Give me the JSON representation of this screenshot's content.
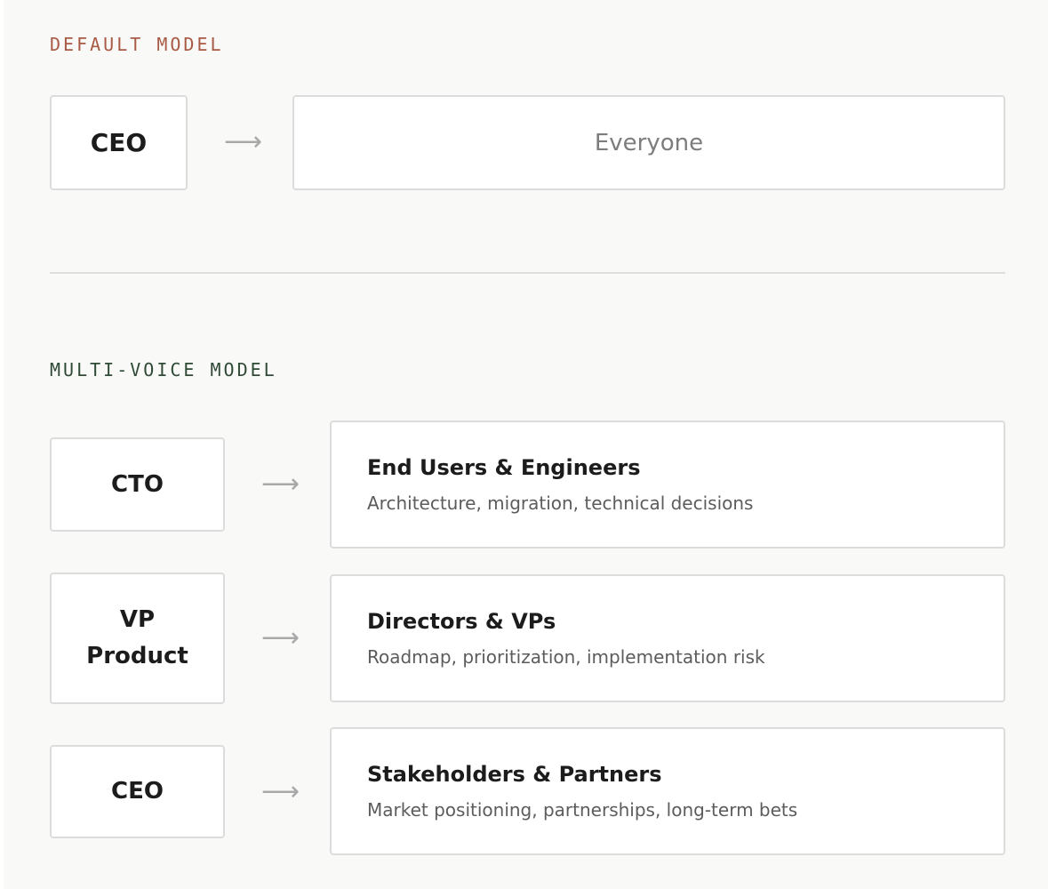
{
  "default_model": {
    "label": "DEFAULT MODEL",
    "label_color": "#a85a44",
    "role": "CEO",
    "arrow": "⟶",
    "audience": "Everyone"
  },
  "multi_voice_model": {
    "label": "MULTI-VOICE MODEL",
    "label_color": "#2f4a35",
    "rows": [
      {
        "role": "CTO",
        "arrow": "⟶",
        "title": "End Users & Engineers",
        "desc": "Architecture, migration, technical decisions"
      },
      {
        "role": "VP Product",
        "arrow": "⟶",
        "title": "Directors & VPs",
        "desc": "Roadmap, prioritization, implementation risk"
      },
      {
        "role": "CEO",
        "arrow": "⟶",
        "title": "Stakeholders & Partners",
        "desc": "Market positioning, partnerships, long-term bets"
      }
    ]
  }
}
